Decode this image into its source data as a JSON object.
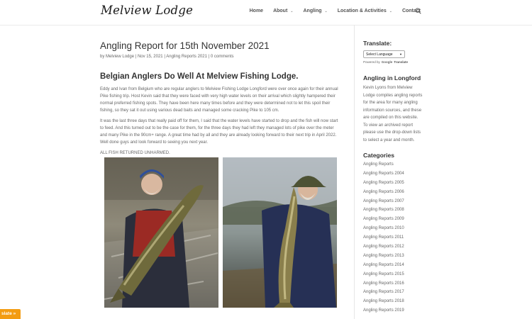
{
  "header": {
    "logo": "Melview Lodge",
    "nav": [
      {
        "label": "Home",
        "dropdown": false
      },
      {
        "label": "About",
        "dropdown": true
      },
      {
        "label": "Angling",
        "dropdown": true
      },
      {
        "label": "Location & Activities",
        "dropdown": true
      },
      {
        "label": "Contact",
        "dropdown": false
      }
    ],
    "search_icon": "search-icon"
  },
  "post": {
    "title": "Angling Report for 15th November 2021",
    "meta": {
      "by": "by",
      "author": "Melview Lodge",
      "sep": "|",
      "date": "Nov 15, 2021",
      "category": "Angling Reports 2021",
      "comments": "0 comments"
    },
    "heading": "Belgian Anglers Do Well At Melview Fishing Lodge.",
    "paragraphs": [
      "Eddy and Ivan from Belgium who are regular anglers to Melview Fishing Lodge Longford were over once again for their annual Pike fishing trip. Host Kevin said that they were faced with very high water levels on their arrival which slightly hampered their normal preferred fishing spots. They have been here many times before and they were determined not to let this spoil their fishing, so they sat it out using various dead baits and managed some cracking Pike to 105 cm.",
      "It was the last three days that really paid off for them, I said that the water levels have started to drop and the fish will now start to feed. And this turned out to be the case for them, for the three days they had left they managed lots of pike over the meter and many Pike in the 90cm+ range. A great time had by all and they are already looking forward to their next trip in April 2022. Well done guys and look forward to seeing you next year.",
      "ALL FISH RETURNED UNHARMED."
    ]
  },
  "sidebar": {
    "translate_title": "Translate:",
    "language_select": "Select Language",
    "powered_by": "Powered by",
    "google": "Google",
    "translate_word": "Translate",
    "angling_title": "Angling in Longford",
    "angling_text": "Kevin Lyons from Melview Lodge compiles angling reports for the area for many angling information sources, and these are compiled on this website. To view an archived report please use the drop-down lists to select a year and month.",
    "categories_title": "Categories",
    "categories": [
      "Angling Reports",
      "Angling Reports 2004",
      "Angling Reports 2005",
      "Angling Reports 2006",
      "Angling Reports 2007",
      "Angling Reports 2008",
      "Angling Reports 2009",
      "Angling Reports 2010",
      "Angling Reports 2011",
      "Angling Reports 2012",
      "Angling Reports 2013",
      "Angling Reports 2014",
      "Angling Reports 2015",
      "Angling Reports 2016",
      "Angling Reports 2017",
      "Angling Reports 2018",
      "Angling Reports 2019"
    ]
  },
  "translate_tab": "slate »",
  "colors": {
    "accent_orange": "#f39c12",
    "text": "#666666",
    "heading": "#333333"
  }
}
